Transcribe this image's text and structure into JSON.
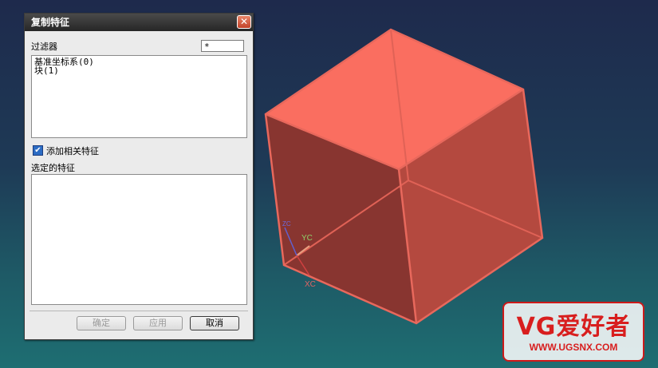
{
  "dialog": {
    "title": "复制特征",
    "close_glyph": "✕",
    "filter_label": "过滤器",
    "filter_value": "*",
    "feature_list": [
      "基准坐标系(0)",
      "块(1)"
    ],
    "add_related_label": "添加相关特征",
    "add_related_checked": true,
    "selected_label": "选定的特征",
    "buttons": {
      "ok": "确定",
      "apply": "应用",
      "cancel": "取消"
    }
  },
  "viewport": {
    "axis_labels": {
      "yc": "YC",
      "xc": "XC",
      "zc": "ZC"
    },
    "cube_color": "#f56a5c"
  },
  "watermark": {
    "main": "VG爱好者",
    "url": "WWW.UGSNX.COM"
  }
}
